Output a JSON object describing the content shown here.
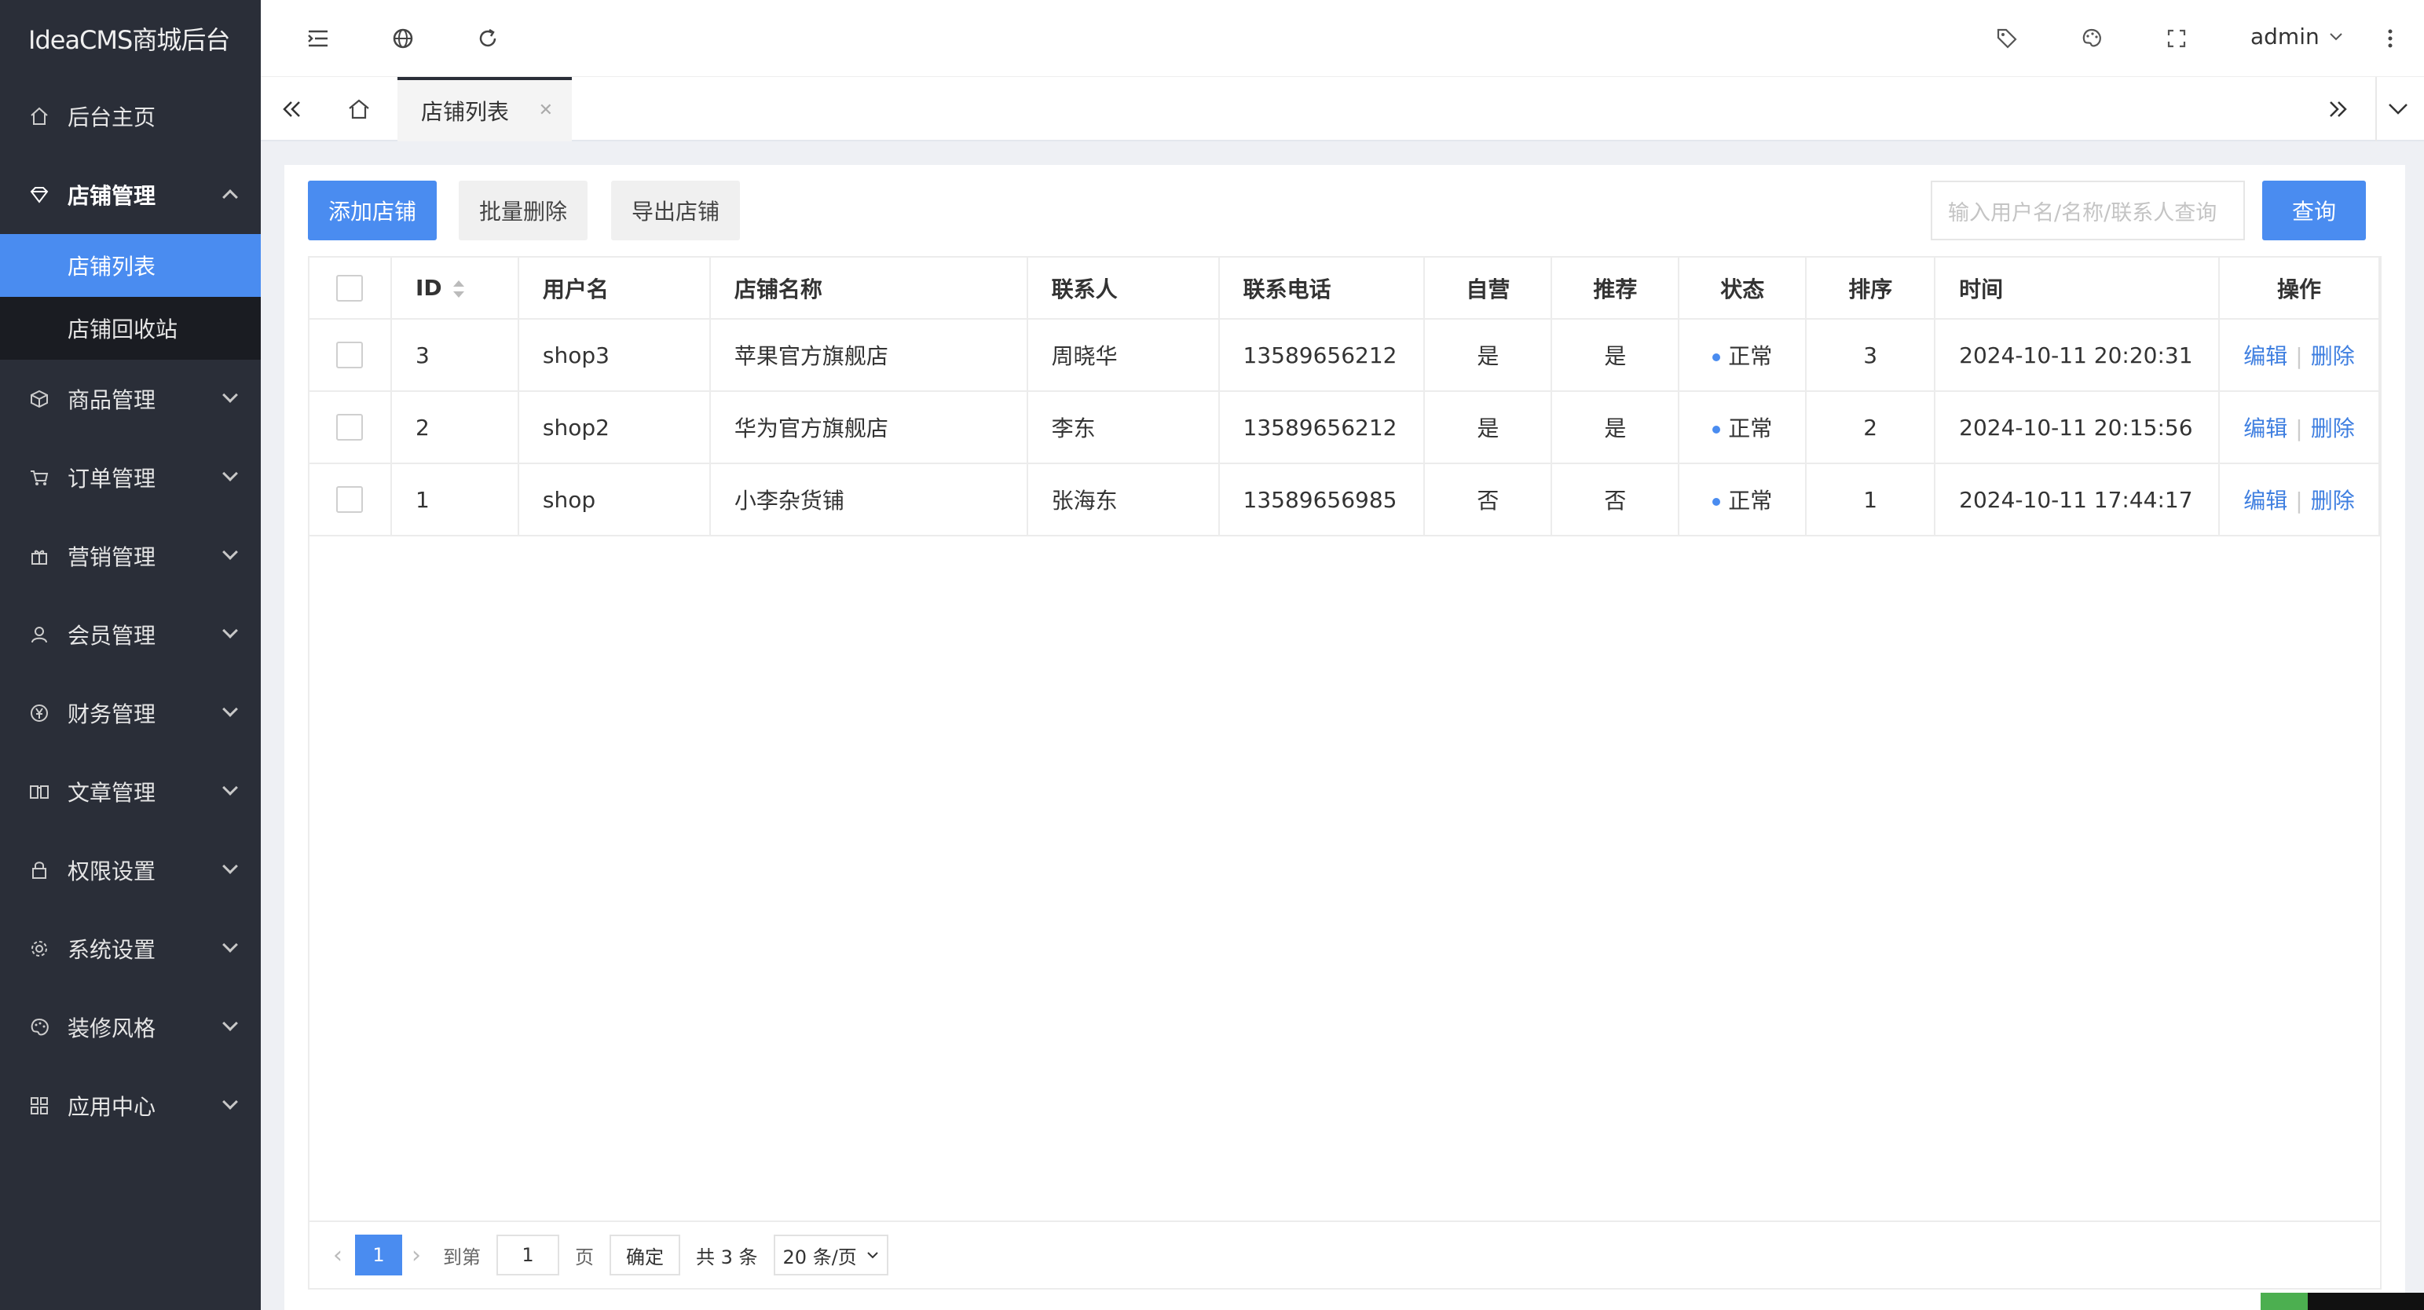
{
  "app": {
    "title": "IdeaCMS商城后台"
  },
  "sidebar": {
    "items": [
      {
        "label": "后台主页",
        "icon": "home-icon"
      },
      {
        "label": "店铺管理",
        "icon": "diamond-icon",
        "expanded": true
      },
      {
        "label": "商品管理",
        "icon": "box-icon"
      },
      {
        "label": "订单管理",
        "icon": "cart-icon"
      },
      {
        "label": "营销管理",
        "icon": "gift-icon"
      },
      {
        "label": "会员管理",
        "icon": "user-icon"
      },
      {
        "label": "财务管理",
        "icon": "yen-icon"
      },
      {
        "label": "文章管理",
        "icon": "book-icon"
      },
      {
        "label": "权限设置",
        "icon": "lock-icon"
      },
      {
        "label": "系统设置",
        "icon": "gear-icon"
      },
      {
        "label": "装修风格",
        "icon": "palette-icon"
      },
      {
        "label": "应用中心",
        "icon": "apps-icon"
      }
    ],
    "sub_items": [
      {
        "label": "店铺列表",
        "active": true
      },
      {
        "label": "店铺回收站"
      }
    ]
  },
  "topbar": {
    "user": "admin"
  },
  "tabs": {
    "active": "店铺列表"
  },
  "toolbar": {
    "add_label": "添加店铺",
    "batch_delete_label": "批量删除",
    "export_label": "导出店铺",
    "search_placeholder": "输入用户名/名称/联系人查询",
    "query_label": "查询"
  },
  "table": {
    "headers": [
      "ID",
      "用户名",
      "店铺名称",
      "联系人",
      "联系电话",
      "自营",
      "推荐",
      "状态",
      "排序",
      "时间",
      "操作"
    ],
    "rows": [
      {
        "id": "3",
        "username": "shop3",
        "name": "苹果官方旗舰店",
        "contact": "周晓华",
        "phone": "13589656212",
        "self": "是",
        "recommend": "是",
        "status": "正常",
        "sort": "3",
        "time": "2024-10-11 20:20:31"
      },
      {
        "id": "2",
        "username": "shop2",
        "name": "华为官方旗舰店",
        "contact": "李东",
        "phone": "13589656212",
        "self": "是",
        "recommend": "是",
        "status": "正常",
        "sort": "2",
        "time": "2024-10-11 20:15:56"
      },
      {
        "id": "1",
        "username": "shop",
        "name": "小李杂货铺",
        "contact": "张海东",
        "phone": "13589656985",
        "self": "否",
        "recommend": "否",
        "status": "正常",
        "sort": "1",
        "time": "2024-10-11 17:44:17"
      }
    ],
    "edit_label": "编辑",
    "delete_label": "删除",
    "action_sep": "|"
  },
  "pager": {
    "current": "1",
    "goto_label": "到第",
    "goto_value": "1",
    "page_label": "页",
    "confirm_label": "确定",
    "total_label": "共 3 条",
    "per_page": "20 条/页"
  },
  "colors": {
    "accent": "#4a8cf0",
    "sidebar_bg": "#2a2e38",
    "link": "#3f7fe0"
  }
}
